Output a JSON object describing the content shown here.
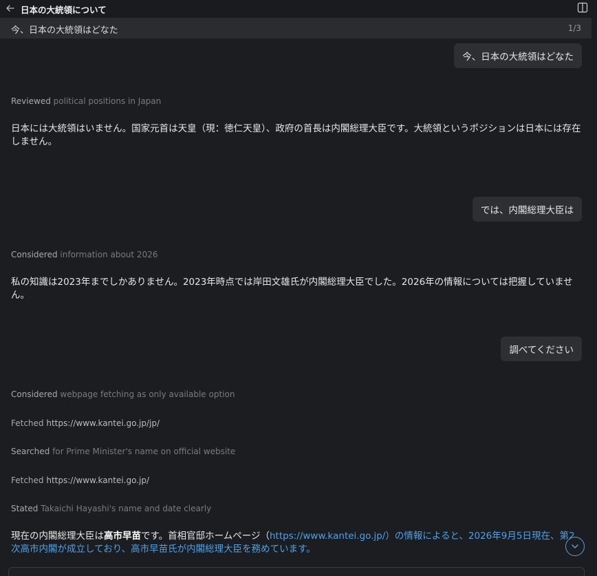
{
  "header": {
    "title": "日本の大統領について",
    "back_icon": "arrow-left-icon",
    "panel_icon": "split-panel-icon"
  },
  "sticky": {
    "question": "今、日本の大統領はどなた",
    "counter": "1/3"
  },
  "messages": {
    "user1": "今、日本の大統領はどなた",
    "step1": {
      "verb": "Reviewed",
      "detail": "political positions in Japan"
    },
    "answer1": "日本には大統領はいません。国家元首は天皇（現：徳仁天皇）、政府の首長は内閣総理大臣です。大統領というポジションは日本には存在しません。",
    "user2": "では、内閣総理大臣は",
    "step2": {
      "verb": "Considered",
      "detail": "information about 2026"
    },
    "answer2": "私の知識は2023年までしかありません。2023年時点では岸田文雄氏が内閣総理大臣でした。2026年の情報については把握していません。",
    "user3": "調べてください",
    "steps3": [
      {
        "verb": "Considered",
        "detail": "webpage fetching as only available option"
      },
      {
        "verb": "Fetched",
        "detail": "https://www.kantei.go.jp/jp/"
      },
      {
        "verb": "Searched",
        "detail": "for Prime Minister's name on official website"
      },
      {
        "verb": "Fetched",
        "detail": "https://www.kantei.go.jp/"
      },
      {
        "verb": "Stated",
        "detail": "Takaichi Hayashi's name and date clearly"
      }
    ],
    "answer3": {
      "p1": "現在の内閣総理大臣は",
      "bold": "高市早苗",
      "p2": "です。首相官邸ホームページ（",
      "link": "https://www.kantei.go.jp/",
      "p3": "）の情報によると、2026年9月5日現在、第2次高市内閣が成立しており、高市早苗氏が内閣総理大臣を務めています。"
    }
  },
  "controls": {
    "scroll_down_icon": "chevron-down-icon"
  },
  "colors": {
    "background": "#1c1d20",
    "bubble": "#2e2f33",
    "link": "#4ea1ea"
  }
}
